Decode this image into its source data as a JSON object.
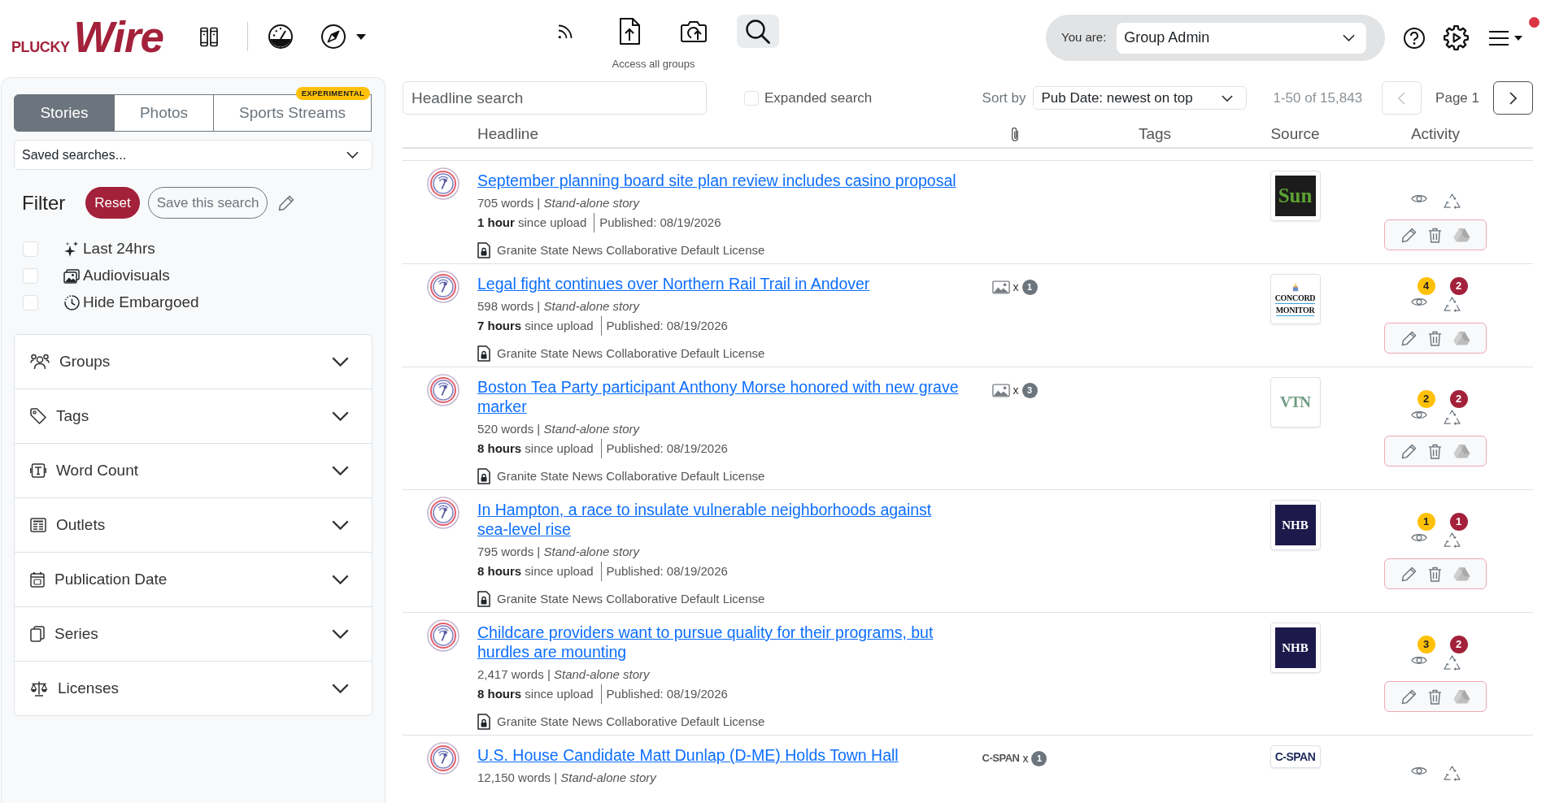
{
  "header": {
    "brand": {
      "prefix": "PLUCKY",
      "name": "Wire"
    },
    "nav": [
      {
        "selected": false
      },
      {
        "selected": false
      },
      {
        "selected": false
      },
      {
        "selected": false
      },
      {
        "selected": false
      },
      {
        "selected": false
      },
      {
        "selected": true
      }
    ],
    "nav_caption": "Access all groups",
    "role_picker": {
      "label": "You are:",
      "value": "Group Admin"
    },
    "menu": {
      "notification": true
    }
  },
  "sidebar": {
    "tabs": [
      {
        "label": "Stories",
        "selected": true
      },
      {
        "label": "Photos",
        "selected": false
      },
      {
        "label": "Sports Streams",
        "selected": false,
        "badge": "EXPERIMENTAL"
      }
    ],
    "saved_searches": {
      "value": "Saved searches..."
    },
    "filter": {
      "title": "Filter",
      "reset": "Reset",
      "save": "Save this search"
    },
    "toggles": [
      {
        "label": "Last 24hrs",
        "checked": false
      },
      {
        "label": "Audiovisuals",
        "checked": false
      },
      {
        "label": "Hide Embargoed",
        "checked": false
      }
    ],
    "sections": [
      {
        "label": "Groups",
        "expanded": false
      },
      {
        "label": "Tags",
        "expanded": false
      },
      {
        "label": "Word Count",
        "expanded": false
      },
      {
        "label": "Outlets",
        "expanded": false
      },
      {
        "label": "Publication Date",
        "expanded": false
      },
      {
        "label": "Series",
        "expanded": false
      },
      {
        "label": "Licenses",
        "expanded": false
      }
    ]
  },
  "toolbar": {
    "search": {
      "placeholder": "Headline search"
    },
    "expanded_search": {
      "label": "Expanded search",
      "checked": false
    },
    "sort": {
      "label": "Sort by",
      "value": "Pub Date: newest on top"
    },
    "range": "1-50 of 15,843",
    "prev": {
      "disabled": true
    },
    "page": "Page 1",
    "next": {
      "disabled": false
    }
  },
  "table": {
    "columns": [
      "Headline",
      "Tags",
      "Source",
      "Activity"
    ],
    "rows": [
      {
        "title": "September planning board site plan review includes casino proposal",
        "meta": "705 words | *Stand-alone story*",
        "age": "**1 hour** since upload",
        "published": "Published: 08/19/2026",
        "license": "Granite State News Collaborative Default License",
        "source": {
          "kind": "sun",
          "lines": [
            "Sun"
          ]
        }
      },
      {
        "title": "Legal fight continues over Northern Rail Trail in Andover",
        "meta": "598 words | *Stand-alone story*",
        "age": "**7 hours** since upload",
        "published": "Published: 08/19/2026",
        "license": "Granite State News Collaborative Default License",
        "attachments": {
          "kind": "image",
          "times": "x",
          "count": "1"
        },
        "source": {
          "kind": "concord",
          "lines": [
            "CONCORD",
            "MONITOR"
          ]
        },
        "activity": {
          "counts": [
            "4",
            "2"
          ]
        }
      },
      {
        "title": "Boston Tea Party participant Anthony Morse honored with new grave marker",
        "meta": "520 words | *Stand-alone story*",
        "age": "**8 hours** since upload",
        "published": "Published: 08/19/2026",
        "license": "Granite State News Collaborative Default License",
        "attachments": {
          "kind": "image",
          "times": "x",
          "count": "3"
        },
        "source": {
          "kind": "vt",
          "lines": [
            "VTN"
          ]
        },
        "activity": {
          "counts": [
            "2",
            "2"
          ]
        }
      },
      {
        "title": "In Hampton, a race to insulate vulnerable neighborhoods against sea-level rise",
        "meta": "795 words | *Stand-alone story*",
        "age": "**8 hours** since upload",
        "published": "Published: 08/19/2026",
        "license": "Granite State News Collaborative Default License",
        "source": {
          "kind": "nhb",
          "lines": [
            "NHB"
          ]
        },
        "activity": {
          "counts": [
            "1",
            "1"
          ]
        }
      },
      {
        "title": "Childcare providers want to pursue quality for their programs, but hurdles are mounting",
        "meta": "2,417 words | *Stand-alone story*",
        "age": "**8 hours** since upload",
        "published": "Published: 08/19/2026",
        "license": "Granite State News Collaborative Default License",
        "source": {
          "kind": "nhb",
          "lines": [
            "NHB"
          ]
        },
        "activity": {
          "counts": [
            "3",
            "2"
          ]
        }
      },
      {
        "title": "U.S. House Candidate Matt Dunlap (D-ME) Holds Town Hall",
        "meta": "12,150 words | *Stand-alone story*",
        "attachments": {
          "kind": "logo",
          "label": "C-SPAN",
          "times": "x",
          "count": "1"
        },
        "source": {
          "kind": "cspan",
          "lines": [
            "C-SPAN"
          ]
        }
      }
    ]
  }
}
